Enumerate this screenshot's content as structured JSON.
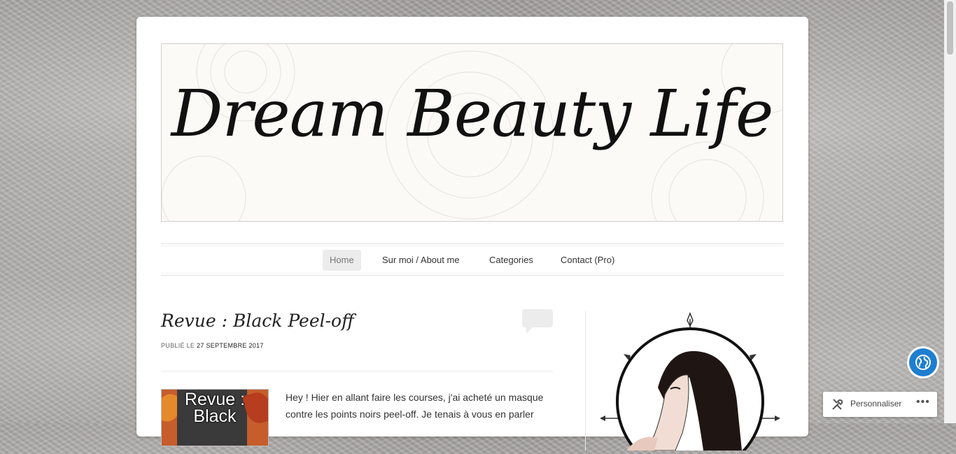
{
  "site": {
    "title": "Dream Beauty Life"
  },
  "nav": {
    "items": [
      {
        "label": "Home",
        "active": true
      },
      {
        "label": "Sur moi / About me",
        "active": false
      },
      {
        "label": "Categories",
        "active": false
      },
      {
        "label": "Contact (Pro)",
        "active": false
      }
    ]
  },
  "post": {
    "title": "Revue : Black Peel-off",
    "meta_prefix": "Publié le",
    "date": "27 septembre 2017",
    "thumbnail_text": "Revue : Black",
    "excerpt": "Hey ! Hier en allant faire les courses, j'ai acheté un masque contre les points noirs peel-off. Je tenais à vous en parler"
  },
  "widgets": {
    "customize_label": "Personnaliser",
    "more_label": "•••"
  },
  "colors": {
    "accent_blue": "#1e7ed0",
    "nav_active_bg": "#ececec"
  }
}
